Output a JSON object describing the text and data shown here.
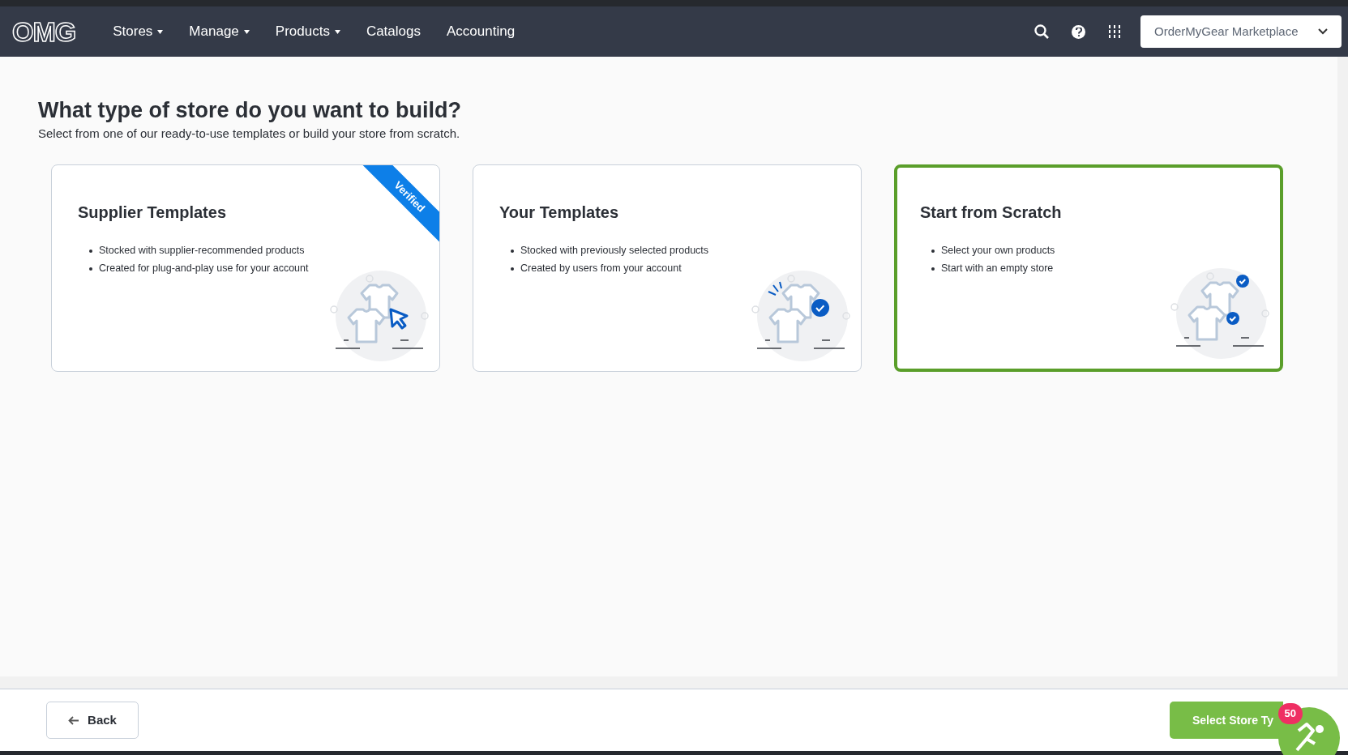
{
  "nav": {
    "logo": "OMG",
    "items": [
      {
        "label": "Stores",
        "dropdown": true
      },
      {
        "label": "Manage",
        "dropdown": true
      },
      {
        "label": "Products",
        "dropdown": true
      },
      {
        "label": "Catalogs",
        "dropdown": false
      },
      {
        "label": "Accounting",
        "dropdown": false
      }
    ],
    "account_select": {
      "value": "OrderMyGear Marketplace"
    }
  },
  "page": {
    "title": "What type of store do you want to build?",
    "subtitle": "Select from one of our ready-to-use templates or build your store from scratch."
  },
  "cards": [
    {
      "title": "Supplier Templates",
      "bullets": [
        "Stocked with supplier-recommended products",
        "Created for plug-and-play use for your account"
      ],
      "ribbon": "Verified",
      "selected": false,
      "kind": "cursor"
    },
    {
      "title": "Your Templates",
      "bullets": [
        "Stocked with previously selected products",
        "Created by users from your account"
      ],
      "selected": false,
      "kind": "check"
    },
    {
      "title": "Start from Scratch",
      "bullets": [
        "Select your own products",
        "Start with an empty store"
      ],
      "selected": true,
      "kind": "double-check"
    }
  ],
  "footer": {
    "back_button": "Back",
    "next_button": "Select Store Ty",
    "badge": "50"
  }
}
